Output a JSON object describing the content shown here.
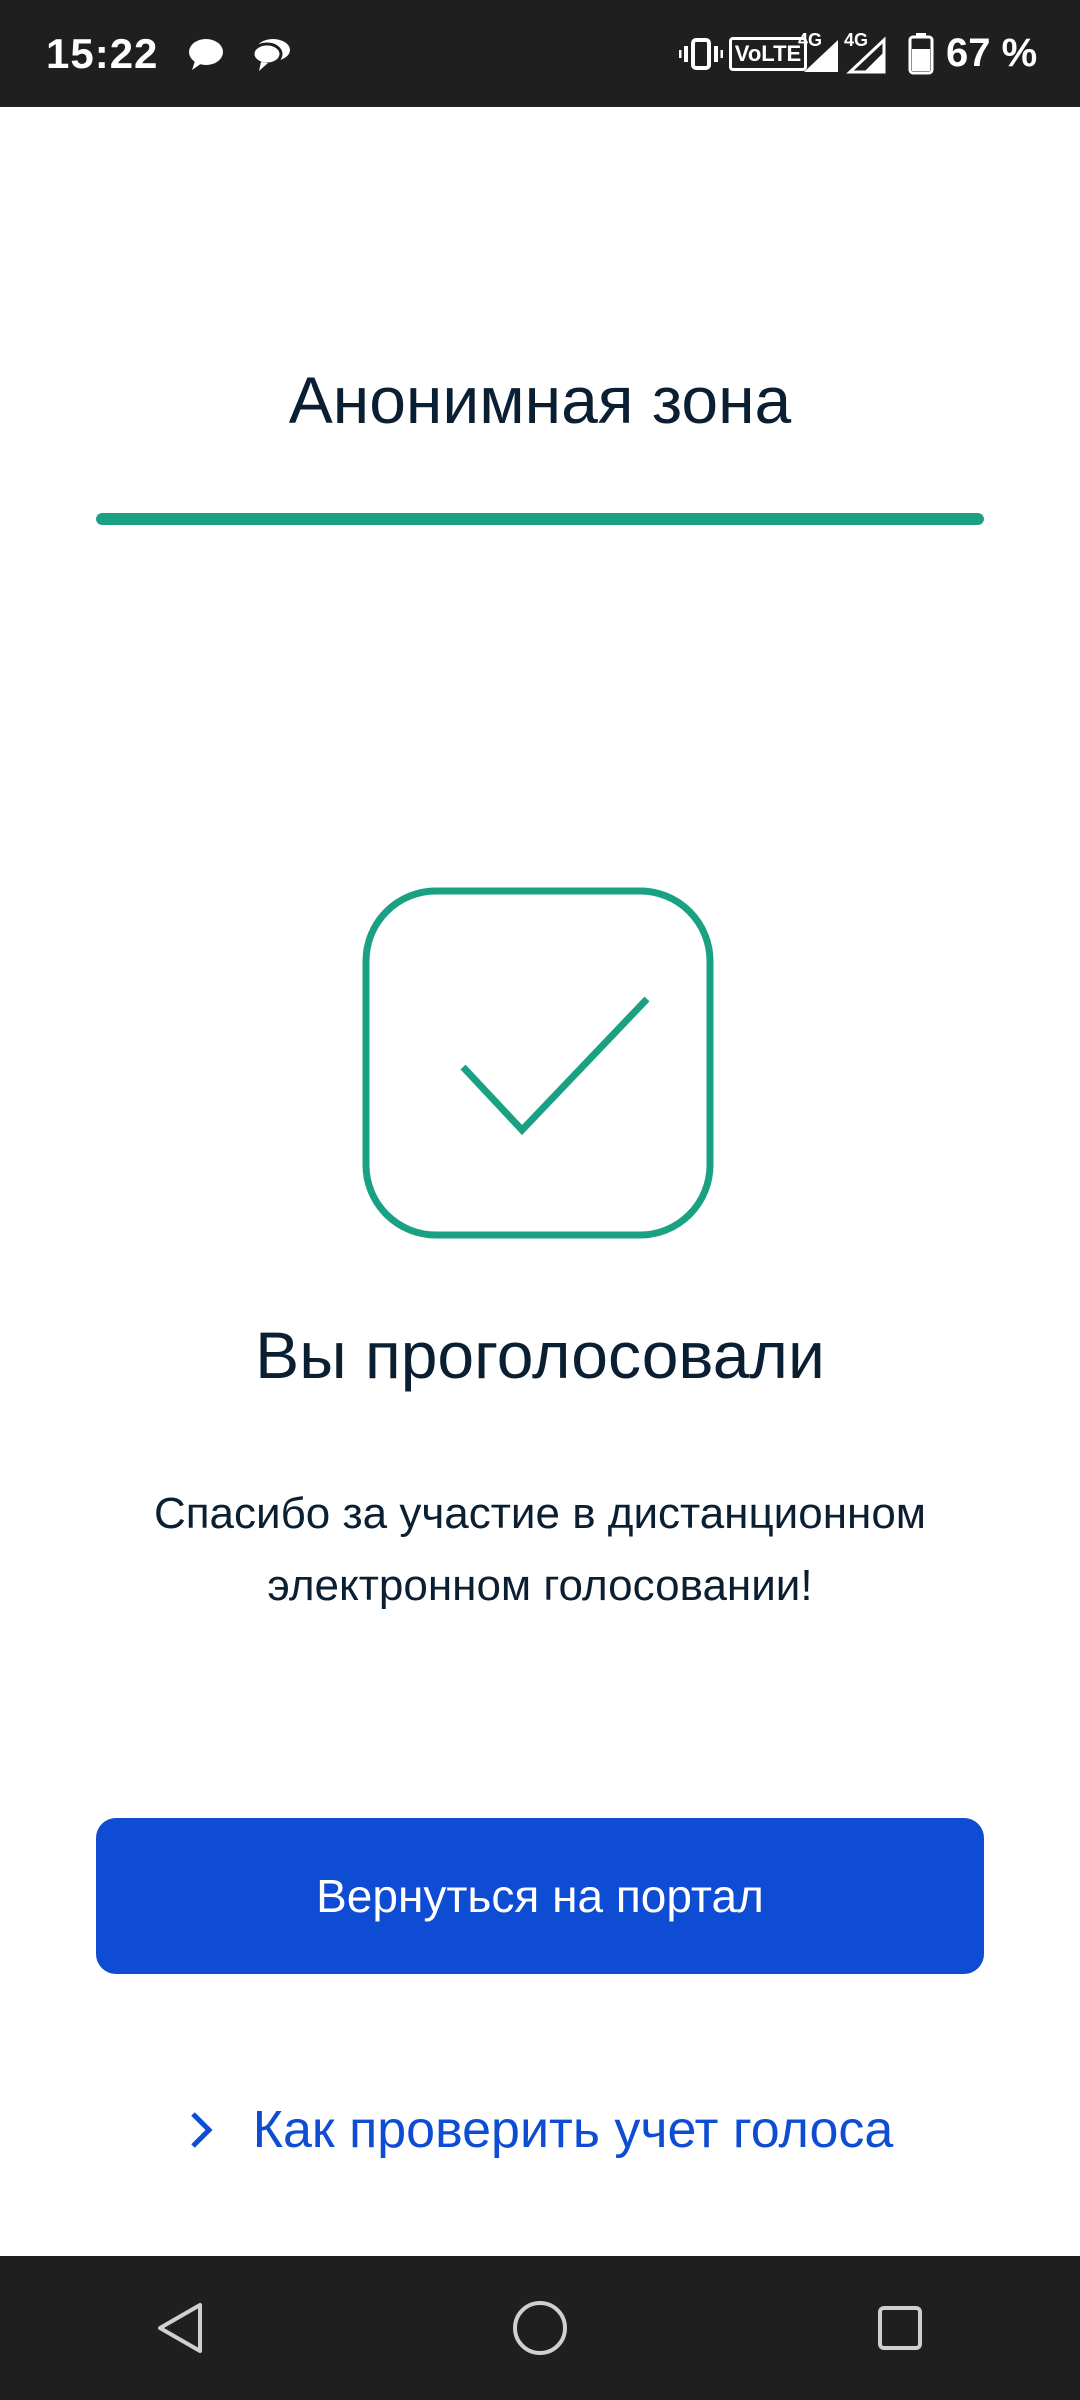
{
  "status_bar": {
    "time": "15:22",
    "icons": [
      "chat-bubble-icon",
      "chat-bubbles-icon",
      "vibrate-icon",
      "volte-icon",
      "signal-4g-icon",
      "signal-4g-icon",
      "battery-icon"
    ],
    "volte_label": "VoLTE",
    "network_label_1": "4G",
    "network_label_2": "4G",
    "battery": "67 %"
  },
  "header": {
    "title": "Анонимная зона",
    "progress": 1.0,
    "accent_color": "#1aa183"
  },
  "result": {
    "icon": "checkmark-icon",
    "title": "Вы проголосовали",
    "message_line1": "Спасибо за участие в дистанционном",
    "message_line2": "электронном голосовании!"
  },
  "actions": {
    "primary_label": "Вернуться на портал",
    "primary_color": "#0d4cd3",
    "link_label": "Как проверить учет голоса",
    "link_icon": "chevron-right-icon"
  },
  "nav_bar": {
    "buttons": [
      "back-triangle-icon",
      "home-circle-icon",
      "recents-square-icon"
    ]
  }
}
